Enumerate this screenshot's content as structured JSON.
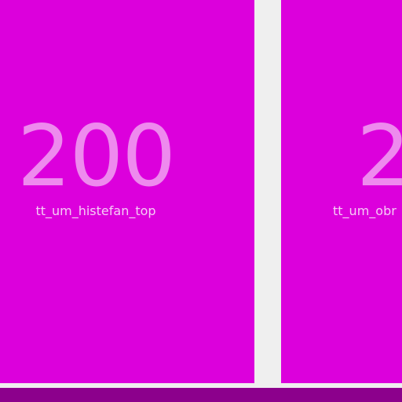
{
  "cards": [
    {
      "value": "200",
      "label": "tt_um_histefan_top"
    },
    {
      "value": "2",
      "label": "tt_um_obr"
    }
  ],
  "colors": {
    "card_background": "#dc00dc",
    "value_text": "#ee8aee",
    "label_text": "#f6cdf6",
    "divider": "#efefef",
    "bottom_bar": "#8c008c"
  }
}
